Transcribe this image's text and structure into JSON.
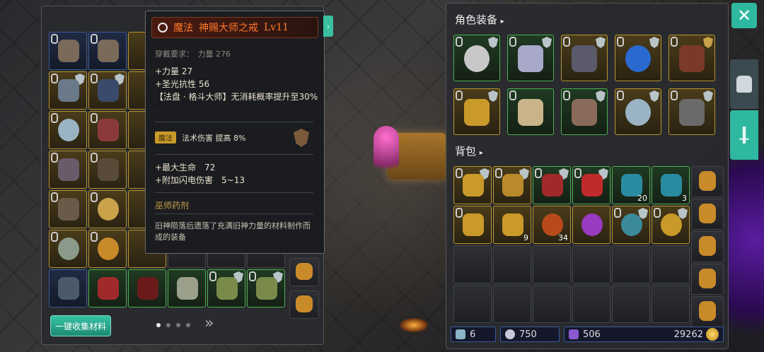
{
  "tooltip": {
    "quality_label": "魔法",
    "item_name": "神赐大师之戒",
    "level": "Lv11",
    "requirement": "穿戴要求：　力量 276",
    "stats": [
      "+力量 27",
      "+圣光抗性 56",
      "【法盘 · 格斗大师】无消耗概率提升至30%"
    ],
    "skill_tag": "魔法",
    "skill_text": "法术伤害 提高 8%",
    "stats2": [
      "+最大生命　72",
      "+附加闪电伤害　5~13"
    ],
    "set_name": "巫师药剂",
    "description": "旧神陨落后遗落了充满旧神力量的材料制作而成的装备"
  },
  "left": {
    "collect_button": "一键收集材料",
    "page_dots": 4,
    "active_dot": 0,
    "next_icon": "double-chevron-right-icon"
  },
  "right": {
    "equipment_title": "角色装备",
    "bag_title": "背包",
    "bag_counts": {
      "r0c4": "20",
      "r0c5": "3",
      "r1c1": "9",
      "r1c2": "34"
    }
  },
  "resources": {
    "attack": "6",
    "armor": "750",
    "crystal": "506",
    "gold": "29262"
  },
  "colors": {
    "accent": "#2fb8a0",
    "legend": "#ff7a2a",
    "gold_border": "#b8962e",
    "green_border": "#4caf50"
  }
}
